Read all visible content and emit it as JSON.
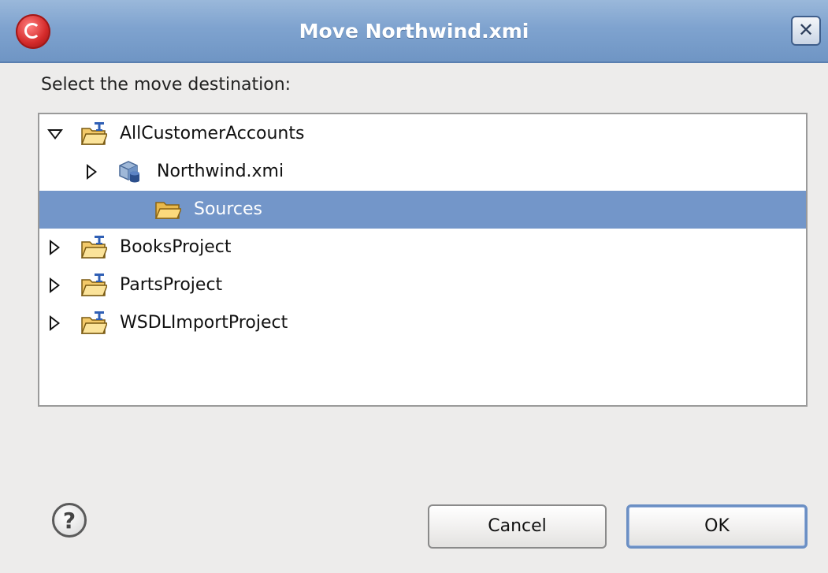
{
  "window": {
    "title": "Move Northwind.xmi",
    "close_label": "✕"
  },
  "prompt": "Select the move destination:",
  "tree": [
    {
      "label": "AllCustomerAccounts",
      "depth": 0,
      "expanded": true,
      "has_children": true,
      "icon": "project-folder-icon",
      "selected": false
    },
    {
      "label": "Northwind.xmi",
      "depth": 1,
      "expanded": false,
      "has_children": true,
      "icon": "model-file-icon",
      "selected": false
    },
    {
      "label": "Sources",
      "depth": 2,
      "expanded": false,
      "has_children": false,
      "icon": "folder-icon",
      "selected": true
    },
    {
      "label": "BooksProject",
      "depth": 0,
      "expanded": false,
      "has_children": true,
      "icon": "project-folder-icon",
      "selected": false
    },
    {
      "label": "PartsProject",
      "depth": 0,
      "expanded": false,
      "has_children": true,
      "icon": "project-folder-icon",
      "selected": false
    },
    {
      "label": "WSDLImportProject",
      "depth": 0,
      "expanded": false,
      "has_children": true,
      "icon": "project-folder-icon",
      "selected": false
    }
  ],
  "buttons": {
    "help_label": "?",
    "cancel_label": "Cancel",
    "ok_label": "OK"
  },
  "colors": {
    "selection": "#7396c9",
    "titlebar": "#7fa3cf",
    "background": "#edeceb"
  }
}
